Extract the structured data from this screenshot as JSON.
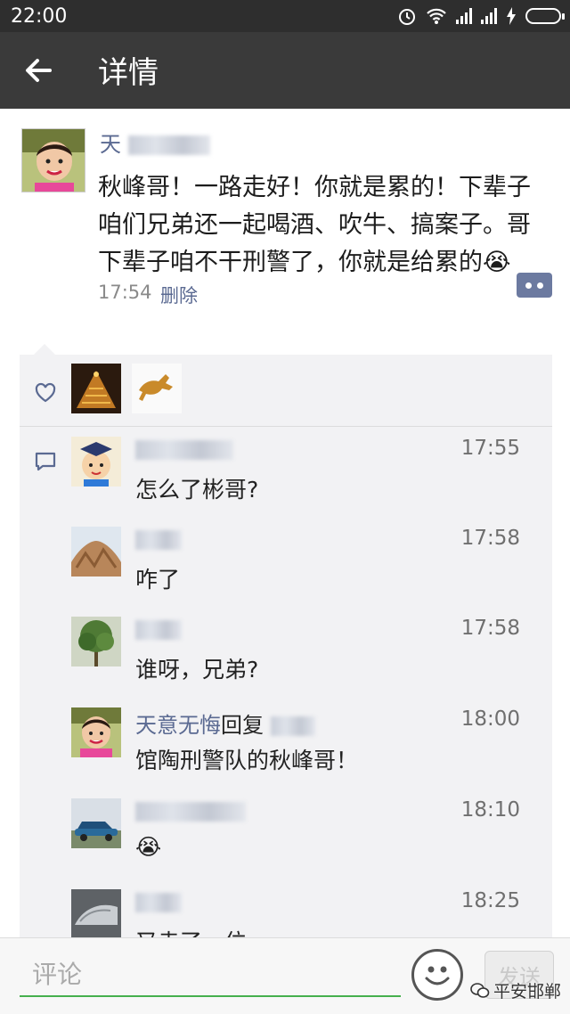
{
  "status_bar": {
    "time": "22:00"
  },
  "header": {
    "title": "详情"
  },
  "post": {
    "author": "天",
    "text": "秋峰哥！一路走好！你就是累的！下辈子咱们兄弟还一起喝酒、吹牛、搞案子。哥下辈子咱不干刑警了，你就是给累的😭",
    "time": "17:54",
    "delete_label": "删除"
  },
  "comments": [
    {
      "author": "",
      "time": "17:55",
      "text": "怎么了彬哥?"
    },
    {
      "author": "",
      "time": "17:58",
      "text": "咋了"
    },
    {
      "author": "",
      "time": "17:58",
      "text": "谁呀，兄弟?"
    },
    {
      "author": "天意无悔",
      "reply_label": "回复",
      "time": "18:00",
      "text": "馆陶刑警队的秋峰哥！"
    },
    {
      "author": "",
      "time": "18:10",
      "text": "😭"
    },
    {
      "author": "",
      "time": "18:25",
      "text": "又走了一位"
    }
  ],
  "input_bar": {
    "placeholder": "评论",
    "send_label": "发送"
  },
  "watermark": {
    "text": "平安邯郸"
  },
  "colors": {
    "name_link": "#5b6a92",
    "title_bar": "#3a3a3a",
    "status_bar": "#2e2e2e",
    "input_underline": "#46b04e"
  },
  "icons": {
    "back": "arrow-left-icon",
    "like": "heart-icon",
    "comment": "comment-icon",
    "more": "more-dots-icon",
    "emoji": "smiley-icon"
  }
}
